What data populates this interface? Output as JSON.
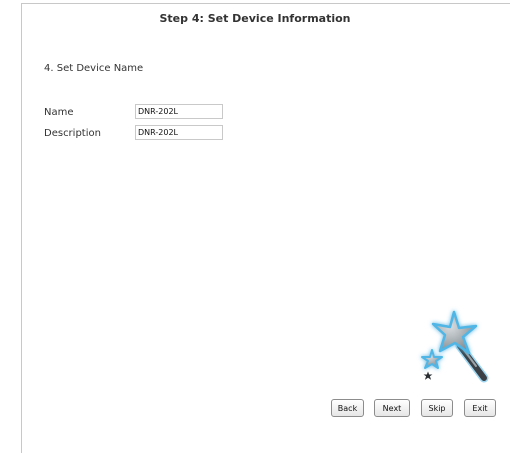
{
  "header": {
    "step_title": "Step 4: Set Device Information"
  },
  "section": {
    "title": "4. Set Device Name"
  },
  "form": {
    "name_label": "Name",
    "name_value": "DNR-202L",
    "description_label": "Description",
    "description_value": "DNR-202L"
  },
  "buttons": {
    "back": "Back",
    "next": "Next",
    "skip": "Skip",
    "exit": "Exit"
  },
  "icons": {
    "wizard": "magic-wand-icon"
  },
  "colors": {
    "star_glow": "#4fb6e6",
    "star_fill": "#9aa3a8",
    "wand_tip": "#2a2f33"
  }
}
